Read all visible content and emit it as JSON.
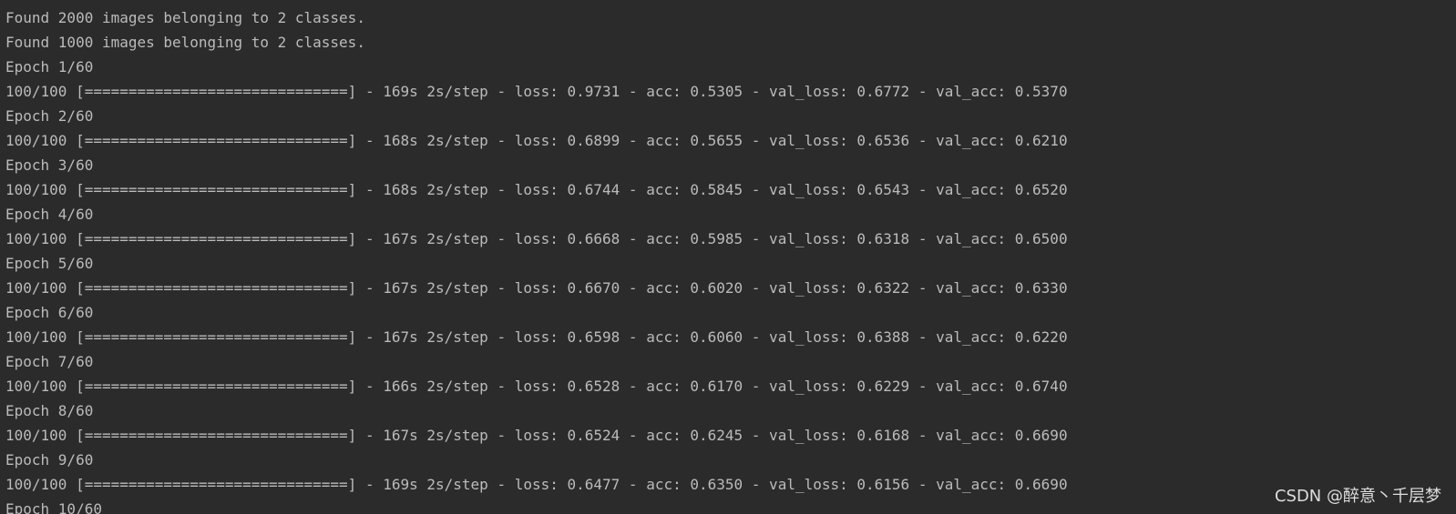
{
  "console": {
    "top_partial_line": "",
    "lines": [
      "Found 2000 images belonging to 2 classes.",
      "Found 1000 images belonging to 2 classes.",
      "Epoch 1/60",
      "100/100 [==============================] - 169s 2s/step - loss: 0.9731 - acc: 0.5305 - val_loss: 0.6772 - val_acc: 0.5370",
      "Epoch 2/60",
      "100/100 [==============================] - 168s 2s/step - loss: 0.6899 - acc: 0.5655 - val_loss: 0.6536 - val_acc: 0.6210",
      "Epoch 3/60",
      "100/100 [==============================] - 168s 2s/step - loss: 0.6744 - acc: 0.5845 - val_loss: 0.6543 - val_acc: 0.6520",
      "Epoch 4/60",
      "100/100 [==============================] - 167s 2s/step - loss: 0.6668 - acc: 0.5985 - val_loss: 0.6318 - val_acc: 0.6500",
      "Epoch 5/60",
      "100/100 [==============================] - 167s 2s/step - loss: 0.6670 - acc: 0.6020 - val_loss: 0.6322 - val_acc: 0.6330",
      "Epoch 6/60",
      "100/100 [==============================] - 167s 2s/step - loss: 0.6598 - acc: 0.6060 - val_loss: 0.6388 - val_acc: 0.6220",
      "Epoch 7/60",
      "100/100 [==============================] - 166s 2s/step - loss: 0.6528 - acc: 0.6170 - val_loss: 0.6229 - val_acc: 0.6740",
      "Epoch 8/60",
      "100/100 [==============================] - 167s 2s/step - loss: 0.6524 - acc: 0.6245 - val_loss: 0.6168 - val_acc: 0.6690",
      "Epoch 9/60",
      "100/100 [==============================] - 169s 2s/step - loss: 0.6477 - acc: 0.6350 - val_loss: 0.6156 - val_acc: 0.6690",
      "Epoch 10/60"
    ],
    "text_color": "#bbbbbb",
    "background_color": "#2b2b2b",
    "error_color": "#c75450"
  },
  "watermark": {
    "text": "CSDN @醉意丶千层梦"
  }
}
